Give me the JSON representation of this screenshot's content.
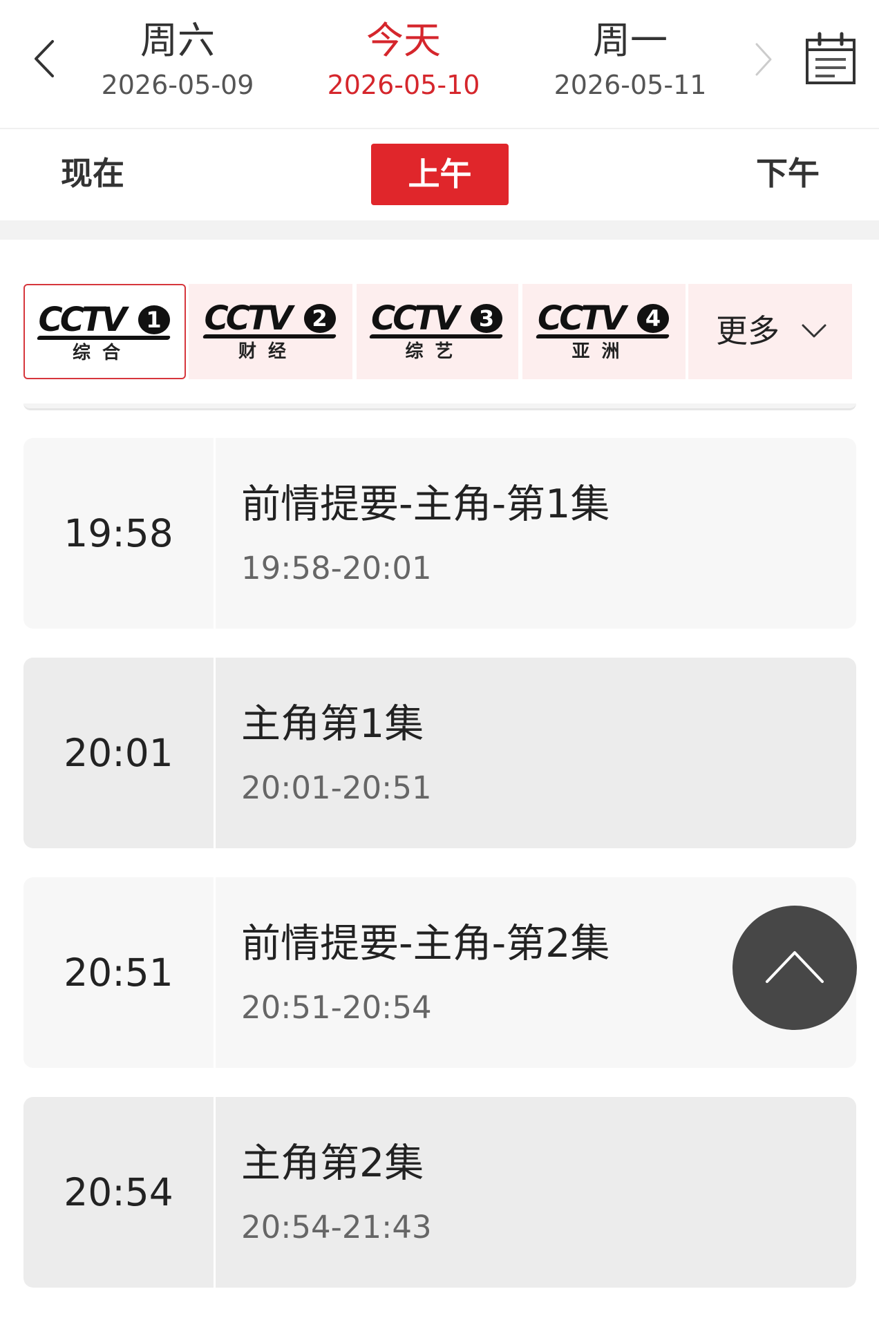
{
  "header": {
    "prev_icon": "chevron-left-icon",
    "next_icon": "chevron-right-icon",
    "calendar_icon": "calendar-icon",
    "days": [
      {
        "name": "周六",
        "date": "2026-05-09",
        "active": false
      },
      {
        "name": "今天",
        "date": "2026-05-10",
        "active": true
      },
      {
        "name": "周一",
        "date": "2026-05-11",
        "active": false
      }
    ]
  },
  "periods": {
    "now": "现在",
    "morning": "上午",
    "afternoon": "下午",
    "selected": "上午"
  },
  "channels": [
    {
      "brand": "CCTV",
      "number": "1",
      "name": "综 合",
      "selected": true
    },
    {
      "brand": "CCTV",
      "number": "2",
      "name": "财 经",
      "selected": false
    },
    {
      "brand": "CCTV",
      "number": "3",
      "name": "综 艺",
      "selected": false
    },
    {
      "brand": "CCTV",
      "number": "4",
      "name": "亚 洲",
      "selected": false
    }
  ],
  "more": {
    "label": "更多",
    "icon": "chevron-down-icon"
  },
  "programs": [
    {
      "time": "19:58",
      "title": "前情提要-主角-第1集",
      "range": "19:58-20:01"
    },
    {
      "time": "20:01",
      "title": "主角第1集",
      "range": "20:01-20:51"
    },
    {
      "time": "20:51",
      "title": "前情提要-主角-第2集",
      "range": "20:51-20:54"
    },
    {
      "time": "20:54",
      "title": "主角第2集",
      "range": "20:54-21:43"
    }
  ],
  "back_to_top_icon": "chevron-up-icon",
  "colors": {
    "accent": "#e0262b",
    "active_text": "#d5262c",
    "channel_bg": "#fdeeee",
    "card_light": "#f7f7f7",
    "card_dark": "#ececec",
    "back_top_bg": "#474747"
  }
}
